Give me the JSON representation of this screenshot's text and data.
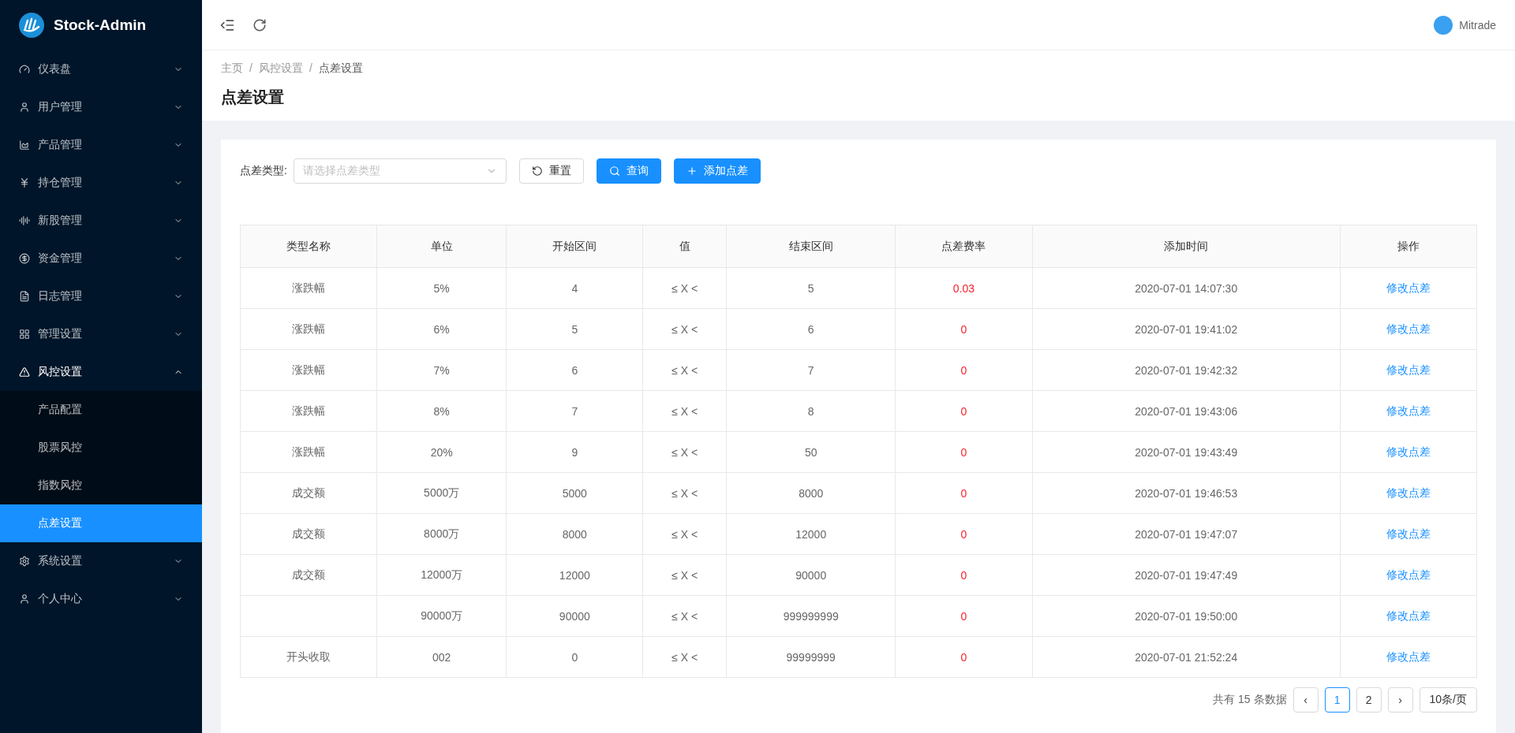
{
  "brand": {
    "title": "Stock-Admin"
  },
  "sidebar": {
    "items": [
      {
        "label": "仪表盘",
        "expanded": false,
        "selected": false
      },
      {
        "label": "用户管理",
        "expanded": false,
        "selected": false
      },
      {
        "label": "产品管理",
        "expanded": false,
        "selected": false
      },
      {
        "label": "持仓管理",
        "expanded": false,
        "selected": false
      },
      {
        "label": "新股管理",
        "expanded": false,
        "selected": false
      },
      {
        "label": "资金管理",
        "expanded": false,
        "selected": false
      },
      {
        "label": "日志管理",
        "expanded": false,
        "selected": false
      },
      {
        "label": "管理设置",
        "expanded": false,
        "selected": false
      },
      {
        "label": "风控设置",
        "expanded": true,
        "selected": false,
        "children": [
          {
            "label": "产品配置",
            "selected": false
          },
          {
            "label": "股票风控",
            "selected": false
          },
          {
            "label": "指数风控",
            "selected": false
          },
          {
            "label": "点差设置",
            "selected": true
          }
        ]
      },
      {
        "label": "系统设置",
        "expanded": false,
        "selected": false
      },
      {
        "label": "个人中心",
        "expanded": false,
        "selected": false
      }
    ]
  },
  "header": {
    "user": "Mitrade"
  },
  "breadcrumb": [
    {
      "label": "主页",
      "separator": "/"
    },
    {
      "label": "风控设置",
      "separator": "/"
    },
    {
      "label": "点差设置"
    }
  ],
  "page_title": "点差设置",
  "filter": {
    "label": "点差类型:",
    "placeholder": "请选择点差类型",
    "buttons": [
      {
        "label": "重置",
        "kind": "reset"
      },
      {
        "label": "查询",
        "kind": "search"
      },
      {
        "label": "添加点差",
        "kind": "add"
      }
    ]
  },
  "table": {
    "columns": [
      "类型名称",
      "单位",
      "开始区间",
      "值",
      "结束区间",
      "点差费率",
      "添加时间",
      "操作"
    ],
    "rows": [
      {
        "type": "涨跌幅",
        "unit": "5%",
        "start": "4",
        "value": "≤ X <",
        "end": "5",
        "rate": "0.03",
        "time": "2020-07-01 14:07:30",
        "action": "修改点差"
      },
      {
        "type": "涨跌幅",
        "unit": "6%",
        "start": "5",
        "value": "≤ X <",
        "end": "6",
        "rate": "0",
        "time": "2020-07-01 19:41:02",
        "action": "修改点差"
      },
      {
        "type": "涨跌幅",
        "unit": "7%",
        "start": "6",
        "value": "≤ X <",
        "end": "7",
        "rate": "0",
        "time": "2020-07-01 19:42:32",
        "action": "修改点差"
      },
      {
        "type": "涨跌幅",
        "unit": "8%",
        "start": "7",
        "value": "≤ X <",
        "end": "8",
        "rate": "0",
        "time": "2020-07-01 19:43:06",
        "action": "修改点差"
      },
      {
        "type": "涨跌幅",
        "unit": "20%",
        "start": "9",
        "value": "≤ X <",
        "end": "50",
        "rate": "0",
        "time": "2020-07-01 19:43:49",
        "action": "修改点差"
      },
      {
        "type": "成交额",
        "unit": "5000万",
        "start": "5000",
        "value": "≤ X <",
        "end": "8000",
        "rate": "0",
        "time": "2020-07-01 19:46:53",
        "action": "修改点差"
      },
      {
        "type": "成交额",
        "unit": "8000万",
        "start": "8000",
        "value": "≤ X <",
        "end": "12000",
        "rate": "0",
        "time": "2020-07-01 19:47:07",
        "action": "修改点差"
      },
      {
        "type": "成交额",
        "unit": "12000万",
        "start": "12000",
        "value": "≤ X <",
        "end": "90000",
        "rate": "0",
        "time": "2020-07-01 19:47:49",
        "action": "修改点差"
      },
      {
        "unit": "90000万",
        "start": "90000",
        "value": "≤ X <",
        "end": "999999999",
        "rate": "0",
        "time": "2020-07-01 19:50:00",
        "action": "修改点差"
      },
      {
        "type": "开头收取",
        "unit": "002",
        "start": "0",
        "value": "≤ X <",
        "end": "99999999",
        "rate": "0",
        "time": "2020-07-01 21:52:24",
        "action": "修改点差"
      }
    ]
  },
  "pagination": {
    "total": "共有 15 条数据",
    "prev": "‹",
    "pages": [
      {
        "label": "1",
        "selected": true
      },
      {
        "label": "2",
        "selected": false
      }
    ],
    "next": "›",
    "page_size": "10条/页"
  }
}
